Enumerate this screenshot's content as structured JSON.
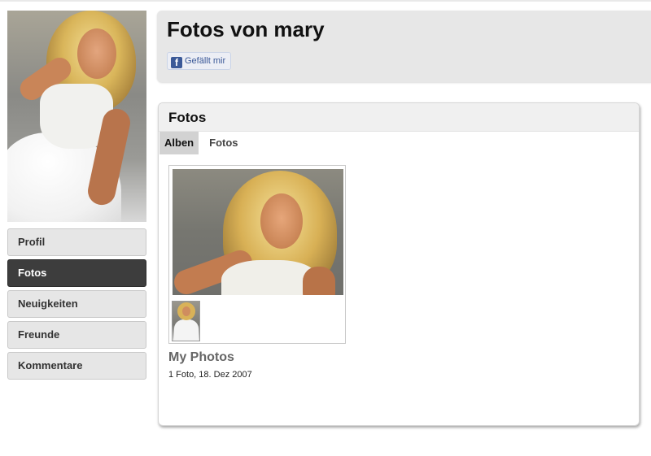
{
  "page": {
    "title": "Fotos von mary",
    "like_button": "Gefällt mir",
    "like_icon": "facebook-icon"
  },
  "sidebar": {
    "items": [
      {
        "label": "Profil",
        "active": false
      },
      {
        "label": "Fotos",
        "active": true
      },
      {
        "label": "Neuigkeiten",
        "active": false
      },
      {
        "label": "Freunde",
        "active": false
      },
      {
        "label": "Kommentare",
        "active": false
      }
    ]
  },
  "photos_panel": {
    "title": "Fotos",
    "tabs": [
      {
        "label": "Alben",
        "active": true
      },
      {
        "label": "Fotos",
        "active": false
      }
    ],
    "albums": [
      {
        "name": "My Photos",
        "meta": "1 Foto, 18. Dez 2007"
      }
    ]
  },
  "colors": {
    "nav_active_bg": "#3d3d3d",
    "nav_bg": "#e6e6e6",
    "header_bg": "#e7e7e7",
    "facebook_blue": "#3b5998"
  }
}
